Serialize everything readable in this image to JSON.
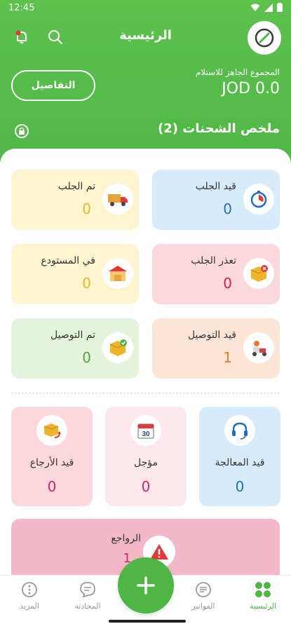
{
  "status": {
    "time": "12:45"
  },
  "header": {
    "title": "الرئيسية",
    "amount_label": "المجموع الجاهز للاستلام",
    "amount_value": "JOD 0.0",
    "details_button": "التفاصيل"
  },
  "summary": {
    "title": "ملخص الشحنات (2)"
  },
  "cards": [
    {
      "label": "قيد الجلب",
      "count": "0",
      "bg": "#d8ebfb",
      "color": "#1e6fc2",
      "icon": "stopwatch-icon"
    },
    {
      "label": "تم الجلب",
      "count": "0",
      "bg": "#fdf5cf",
      "color": "#e8b62a",
      "icon": "truck-icon"
    },
    {
      "label": "تعذر الجلب",
      "count": "0",
      "bg": "#fbd8dc",
      "color": "#d9233a",
      "icon": "box-error-icon"
    },
    {
      "label": "في المستودع",
      "count": "0",
      "bg": "#fdf5cf",
      "color": "#e8b62a",
      "icon": "warehouse-icon"
    },
    {
      "label": "قيد التوصيل",
      "count": "1",
      "bg": "#fde5d6",
      "color": "#e57b2e",
      "icon": "delivery-icon"
    },
    {
      "label": "تم التوصيل",
      "count": "0",
      "bg": "#e4f3dc",
      "color": "#4fa63d",
      "icon": "box-check-icon"
    }
  ],
  "bottom_cards": [
    {
      "label": "قيد المعالجة",
      "count": "0",
      "bg": "#d8ebfb",
      "color": "#1e6fc2",
      "icon": "headset-icon"
    },
    {
      "label": "مؤجل",
      "count": "0",
      "bg": "#fce8ec",
      "color": "#d6246a",
      "icon": "calendar-icon",
      "calendar_day": "30"
    },
    {
      "label": "قيد الأرجاع",
      "count": "0",
      "bg": "#fbd8dc",
      "color": "#d6246a",
      "icon": "box-return-icon"
    }
  ],
  "returns": {
    "label": "الرواجع",
    "count": "1",
    "icon": "warning-icon"
  },
  "nav": [
    {
      "label": "الرئيسية",
      "icon": "grid-icon",
      "active": true
    },
    {
      "label": "الفواتير",
      "icon": "invoice-icon",
      "active": false
    },
    {
      "label": "المحادثة",
      "icon": "chat-icon",
      "active": false
    },
    {
      "label": "المزيد",
      "icon": "more-icon",
      "active": false
    }
  ],
  "colors": {
    "brand_green": "#4fb646"
  }
}
